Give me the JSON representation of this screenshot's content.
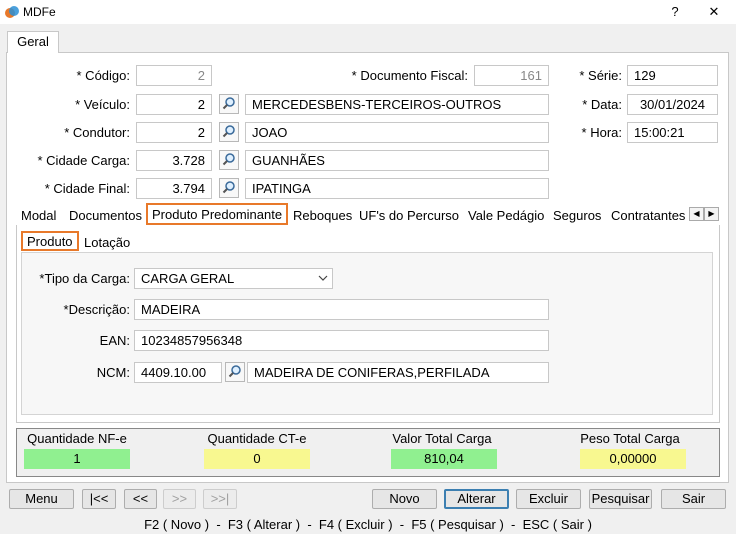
{
  "window": {
    "title": "MDFe",
    "help": "?",
    "close": "✕"
  },
  "outer_tab": "Geral",
  "header": {
    "codigo": {
      "label": "* Código:",
      "value": "2"
    },
    "veiculo": {
      "label": "* Veículo:",
      "code": "2",
      "desc": "MERCEDESBENS-TERCEIROS-OUTROS"
    },
    "condutor": {
      "label": "* Condutor:",
      "code": "2",
      "desc": "JOAO"
    },
    "cidade_carga": {
      "label": "* Cidade Carga:",
      "code": "3.728",
      "desc": "GUANHÃES"
    },
    "cidade_final": {
      "label": "* Cidade Final:",
      "code": "3.794",
      "desc": "IPATINGA"
    },
    "documento_fiscal": {
      "label": "* Documento Fiscal:",
      "value": "161"
    },
    "serie": {
      "label": "* Série:",
      "value": "129"
    },
    "data": {
      "label": "* Data:",
      "value": "30/01/2024"
    },
    "hora": {
      "label": "* Hora:",
      "value": "15:00:21"
    }
  },
  "tabs": [
    "Modal",
    "Documentos",
    "Produto Predominante",
    "Reboques",
    "UF's do Percurso",
    "Vale Pedágio",
    "Seguros",
    "Contratantes"
  ],
  "active_tab": "Produto Predominante",
  "subtabs": [
    "Produto",
    "Lotação"
  ],
  "produto": {
    "tipo_carga": {
      "label": "*Tipo da Carga:",
      "value": "CARGA GERAL"
    },
    "descricao": {
      "label": "*Descrição:",
      "value": "MADEIRA"
    },
    "ean": {
      "label": "EAN:",
      "value": "10234857956348"
    },
    "ncm": {
      "label": "NCM:",
      "code": "4409.10.00",
      "desc": "MADEIRA DE CONIFERAS,PERFILADA"
    }
  },
  "totals": [
    {
      "label": "Quantidade NF-e",
      "value": "1",
      "color": "#90f090"
    },
    {
      "label": "Quantidade CT-e",
      "value": "0",
      "color": "#f8f890"
    },
    {
      "label": "Valor Total Carga",
      "value": "810,04",
      "color": "#90f090"
    },
    {
      "label": "Peso Total Carga",
      "value": "0,00000",
      "color": "#f8f890"
    }
  ],
  "buttons": {
    "menu": "Menu",
    "first": "|<<",
    "prev": "<<",
    "next": ">>",
    "last": ">>|",
    "novo": "Novo",
    "alterar": "Alterar",
    "excluir": "Excluir",
    "pesquisar": "Pesquisar",
    "sair": "Sair"
  },
  "status_bar": "F2 ( Novo )  -  F3 ( Alterar )  -  F4 ( Excluir )  -  F5 ( Pesquisar )  -  ESC ( Sair )",
  "colors": {
    "highlight": "#e8792a",
    "green": "#90f090",
    "yellow": "#f8f890"
  }
}
